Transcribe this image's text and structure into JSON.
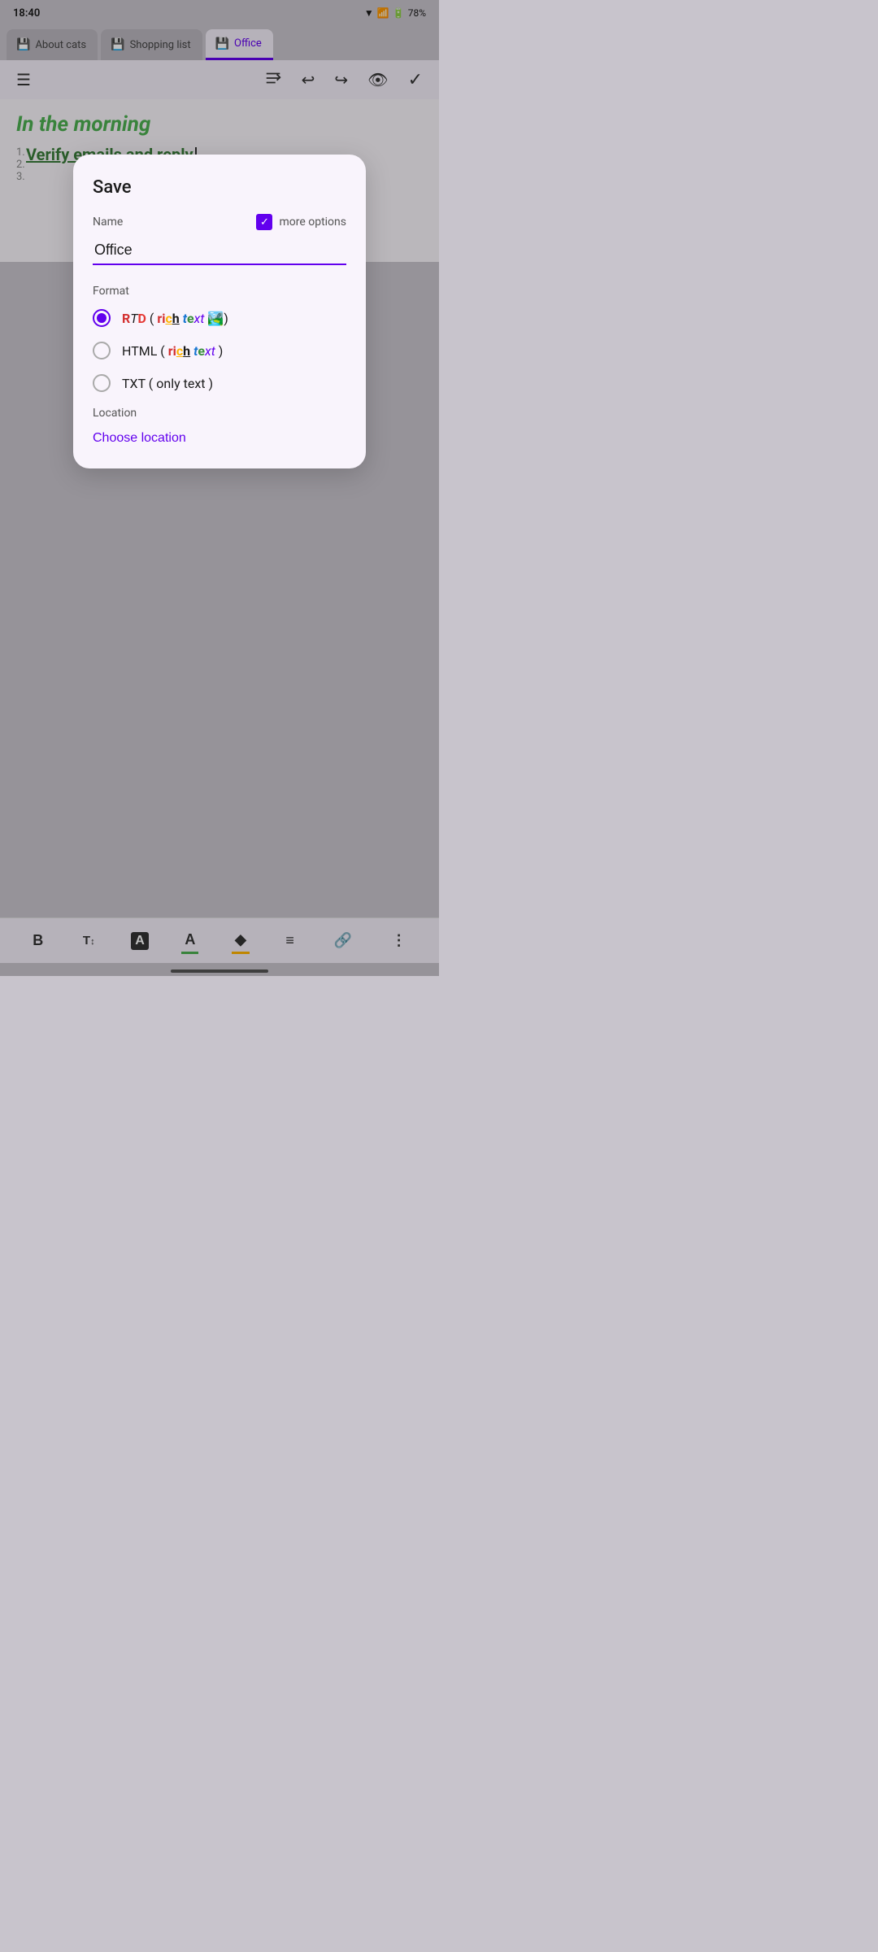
{
  "statusBar": {
    "time": "18:40",
    "battery": "78%",
    "icons": "📶🔋"
  },
  "tabs": [
    {
      "id": "about-cats",
      "label": "About cats",
      "icon": "💾",
      "active": false
    },
    {
      "id": "shopping-list",
      "label": "Shopping list",
      "icon": "💾",
      "active": false
    },
    {
      "id": "office",
      "label": "Office",
      "icon": "💾",
      "active": true
    }
  ],
  "toolbar": {
    "menuIcon": "☰",
    "formatIcon": "⬆",
    "undoIcon": "↩",
    "redoIcon": "↪",
    "eyeIcon": "👁",
    "checkIcon": "✓"
  },
  "content": {
    "heading": "In the morning",
    "listItem1": "Verify emails and reply"
  },
  "dialog": {
    "title": "Save",
    "nameLabel": "Name",
    "moreOptionsLabel": "more options",
    "nameValue": "Office",
    "formatLabel": "Format",
    "formats": [
      {
        "id": "rtd",
        "label": "RTD ( rich text 🏞️)",
        "selected": true
      },
      {
        "id": "html",
        "label": "HTML ( rich text )",
        "selected": false
      },
      {
        "id": "txt",
        "label": "TXT ( only text )",
        "selected": false
      }
    ],
    "locationLabel": "Location",
    "chooseLocationLabel": "Choose location"
  },
  "formatToolbar": {
    "bold": "B",
    "fontSize": "T↕",
    "textColor": "A",
    "highlight": "A",
    "fillColor": "◆",
    "align": "≡",
    "link": "🔗",
    "more": "⋮"
  }
}
